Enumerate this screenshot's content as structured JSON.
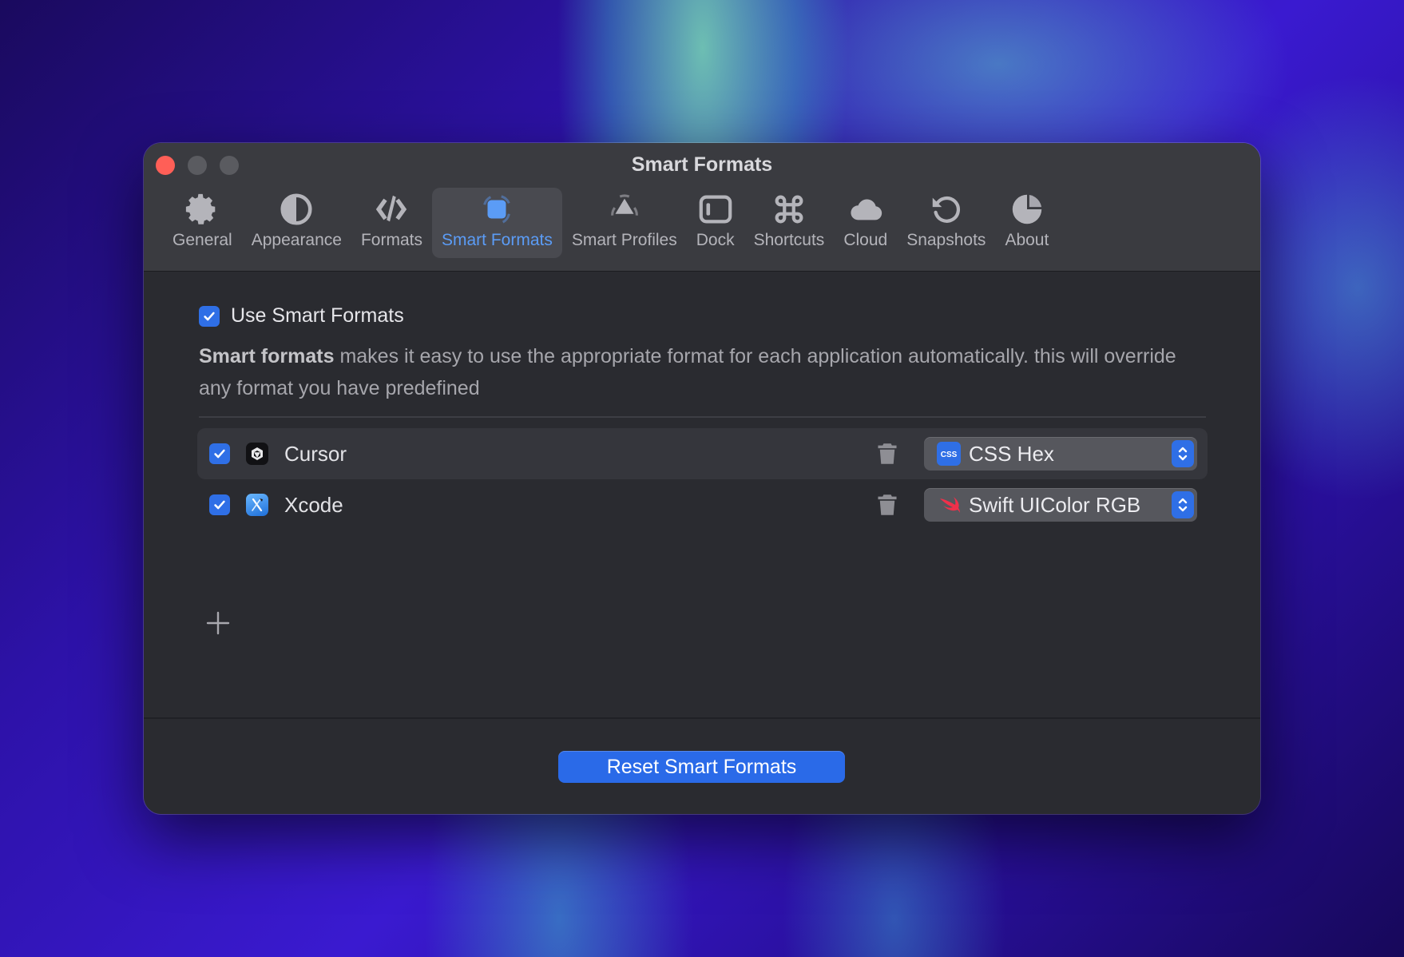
{
  "window": {
    "title": "Smart Formats"
  },
  "toolbar": {
    "tabs": [
      {
        "label": "General",
        "icon": "gear-icon"
      },
      {
        "label": "Appearance",
        "icon": "half-circle-icon"
      },
      {
        "label": "Formats",
        "icon": "code-brackets-icon"
      },
      {
        "label": "Smart Formats",
        "icon": "smart-square-icon",
        "active": true
      },
      {
        "label": "Smart Profiles",
        "icon": "triangle-profile-icon"
      },
      {
        "label": "Dock",
        "icon": "sidebar-icon"
      },
      {
        "label": "Shortcuts",
        "icon": "command-icon"
      },
      {
        "label": "Cloud",
        "icon": "cloud-icon"
      },
      {
        "label": "Snapshots",
        "icon": "history-icon"
      },
      {
        "label": "About",
        "icon": "pie-icon"
      }
    ]
  },
  "settings": {
    "use_smart_formats": {
      "label": "Use Smart Formats",
      "checked": true
    },
    "description_bold": "Smart formats",
    "description_rest": " makes it easy to use the appropriate format for each application automatically. this will override any format you have predefined"
  },
  "apps": [
    {
      "name": "Cursor",
      "checked": true,
      "icon": "cursor-app-icon",
      "format": "CSS Hex",
      "format_icon": "css-icon"
    },
    {
      "name": "Xcode",
      "checked": true,
      "icon": "xcode-app-icon",
      "format": "Swift UIColor RGB",
      "format_icon": "swift-icon"
    }
  ],
  "footer": {
    "reset_label": "Reset Smart Formats"
  },
  "colors": {
    "accent": "#2f6fe6",
    "active_tab_text": "#5b9cf6",
    "close": "#ff5f57"
  }
}
